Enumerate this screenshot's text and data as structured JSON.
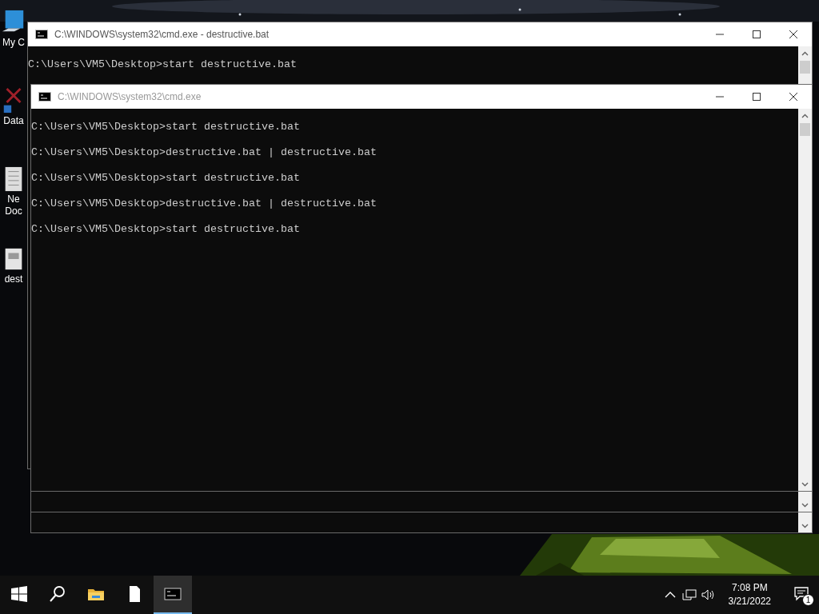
{
  "desktop_icons": [
    {
      "kind": "computer",
      "label": [
        "My C"
      ]
    },
    {
      "kind": "shortcut",
      "label": [
        "Data"
      ]
    },
    {
      "kind": "document",
      "label": [
        "Ne",
        "Doc"
      ]
    },
    {
      "kind": "batch",
      "label": [
        "dest"
      ]
    }
  ],
  "windows": [
    {
      "title": "C:\\WINDOWS\\system32\\cmd.exe - destructive.bat",
      "active": true,
      "lines": [
        "C:\\Users\\VM5\\Desktop>start destructive.bat"
      ]
    },
    {
      "title": "C:\\WINDOWS\\system32\\cmd.exe",
      "active": false,
      "lines": [
        "C:\\Users\\VM5\\Desktop>start destructive.bat",
        "C:\\Users\\VM5\\Desktop>destructive.bat | destructive.bat",
        "C:\\Users\\VM5\\Desktop>start destructive.bat",
        "C:\\Users\\VM5\\Desktop>destructive.bat | destructive.bat",
        "C:\\Users\\VM5\\Desktop>start destructive.bat"
      ]
    }
  ],
  "taskbar": {
    "items": [
      {
        "kind": "start",
        "selected": false
      },
      {
        "kind": "search",
        "selected": false
      },
      {
        "kind": "explorer",
        "selected": false
      },
      {
        "kind": "file",
        "selected": false
      },
      {
        "kind": "terminal",
        "selected": true
      }
    ],
    "clock": {
      "time": "7:08 PM",
      "date": "3/21/2022"
    },
    "notifications": {
      "count": "1"
    }
  }
}
